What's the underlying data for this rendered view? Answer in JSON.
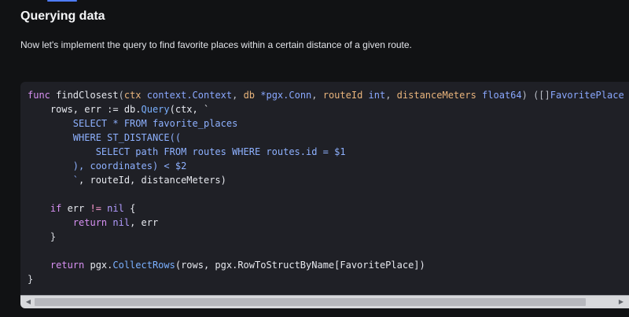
{
  "article": {
    "section_title": "Querying data",
    "intro": "Now let's implement the query to find favorite places within a certain distance of a given route."
  },
  "code": {
    "line1": {
      "p1": "func",
      "p2": " findClosest",
      "p3": "(",
      "p4": "ctx",
      "p5": " context.Context",
      "p6": ", ",
      "p7": "db",
      "p8": " *pgx.Conn",
      "p9": ", ",
      "p10": "routeId",
      "p11": " int",
      "p12": ", ",
      "p13": "distanceMeters",
      "p14": " float64",
      "p15": ") ([]",
      "p16": "FavoritePlace"
    },
    "line2": {
      "p1": "    rows, err := db.",
      "p2": "Query",
      "p3": "(ctx, `"
    },
    "line3": "        SELECT * FROM favorite_places",
    "line4": "        WHERE ST_DISTANCE((",
    "line5": "            SELECT path FROM routes WHERE routes.id = $1",
    "line6": "        ), coordinates) < $2",
    "line7": {
      "p1": "        `",
      "p2": ", routeId, distanceMeters)"
    },
    "line8": "",
    "line9": {
      "p1": "    if",
      "p2": " err ",
      "p3": "!=",
      "p4": " nil",
      "p5": " {"
    },
    "line10": {
      "p1": "        return",
      "p2": " nil",
      "p3": ", err"
    },
    "line11": "    }",
    "line12": "",
    "line13": {
      "p1": "    return",
      "p2": " pgx.",
      "p3": "CollectRows",
      "p4": "(rows, pgx.RowToStructByName[FavoritePlace])"
    },
    "line14": "}"
  },
  "scrollbar": {
    "left_arrow": "◀",
    "right_arrow": "▶",
    "position_fraction": 0.0,
    "visible_fraction": 0.95
  },
  "colors": {
    "background": "#111214",
    "code_background": "#1f2026",
    "accent": "#4f7cff"
  }
}
